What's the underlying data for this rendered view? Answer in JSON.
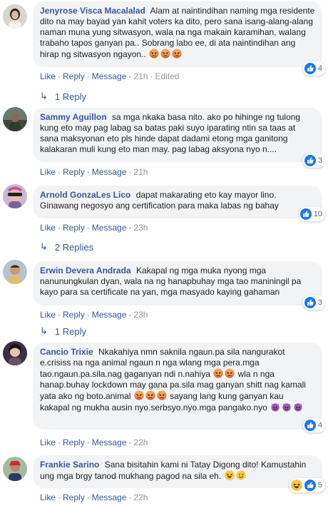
{
  "actions": {
    "like": "Like",
    "reply": "Reply",
    "message": "Message",
    "sep": "·"
  },
  "comments": [
    {
      "author": "Jenyrose Visca Macalalad",
      "text": "Alam at naintindihan naming mga residente dito na may bayad yan kahit voters ka dito, pero sana isang-alang-alang naman muna yung sitwasyon, wala na nga makain karamihan, walang trabaho tapos ganyan pa.. Sobrang labo ee, di ata naintindihan ang hirap ng sitwasyon ngayon..",
      "emojis": [
        "angry-emoji",
        "angry-emoji",
        "angry-emoji"
      ],
      "time": "21h",
      "edited": "Edited",
      "reactions": {
        "count": "4",
        "icons": [
          "like-icon"
        ]
      },
      "replies_label": "1 Reply"
    },
    {
      "author": "Sammy Aguillon",
      "text": "sa mga nkaka basa nito. ako po hihinge ng tulong kung eto may pag labag sa batas paki suyo iparating ntin sa taas at sana maksyonan eto pls hinde dapat dadami etong mga ganitong kalakaran muli kung eto man may. pag labag aksyona nyo n....",
      "time": "21h",
      "reactions": {
        "count": "3",
        "icons": [
          "like-icon"
        ]
      }
    },
    {
      "author": "Arnold GonzaLes Lico",
      "text": "dapat makarating eto kay mayor lino. Ginawang negosyo ang certification para maka labas ng bahay",
      "time": "23h",
      "reactions": {
        "count": "10",
        "icons": [
          "like-icon"
        ]
      },
      "replies_label": "2 Replies"
    },
    {
      "author": "Erwin Devera Andrada",
      "text": "Kakapal ng mga muka nyong mga nanunungkulan dyan, wala na ng hanapbuhay mga tao maniningil pa kayo para sa certificate na yan, mga masyado kaying gahaman",
      "time": "23h",
      "reactions": {
        "count": "3",
        "icons": [
          "like-icon"
        ]
      },
      "replies_label": "1 Reply"
    },
    {
      "author": "Cancio Trixie",
      "text1": "Nkakahiya nmn saknila ngaun.pa sila nangurakot e.crisiss na nga animal ngaun n nga wlang mga pera.mga tao.ngaun.pa.sila.nag gaganyan ndi n.nahiya",
      "text2": "wla n nga hanap.buhay lockdown may gana pa.sila mag ganyan shitt nag kamali yata ako ng boto.animal",
      "text3": "sayang lang kung ganyan kau kakapal ng mukha ausin nyo.serbsyo.nyo.mga pangako.nyo",
      "time": "22h",
      "reactions": {
        "count": "4",
        "icons": [
          "like-icon"
        ]
      }
    },
    {
      "author": "Frankie Sarino",
      "text": "Sana bisitahin kami ni Tatay Digong dito! Kamustahin ung mga brgy tanod mukhang pagod na sila eh.",
      "time": "22h",
      "reactions": {
        "count": "5",
        "icons": [
          "haha-icon",
          "like-icon"
        ]
      }
    }
  ]
}
